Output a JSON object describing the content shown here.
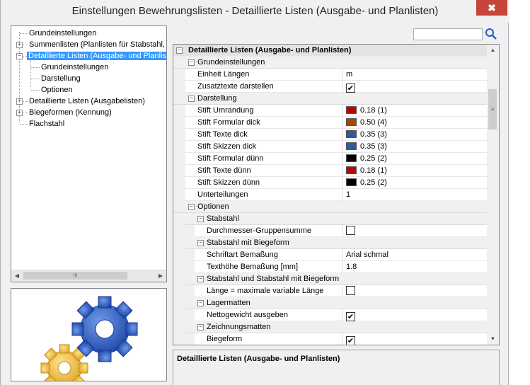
{
  "window": {
    "title": "Einstellungen Bewehrungslisten - Detaillierte Listen (Ausgabe- und Planlisten)",
    "close_label": "✖"
  },
  "tree": {
    "items": [
      {
        "label": "Grundeinstellungen"
      },
      {
        "label": "Summenlisten (Planlisten für Stabstahl, Ma"
      },
      {
        "label": "Detaillierte Listen (Ausgabe- und Planliste"
      },
      {
        "label": "Grundeinstellungen"
      },
      {
        "label": "Darstellung"
      },
      {
        "label": "Optionen"
      },
      {
        "label": "Detaillierte Listen (Ausgabelisten)"
      },
      {
        "label": "Biegeformen (Kennung)"
      },
      {
        "label": "Flachstahl"
      }
    ],
    "scroll_thumb": "III"
  },
  "search": {
    "value": "",
    "placeholder": ""
  },
  "colors": {
    "red": "#c00000",
    "brown": "#a04b00",
    "blue": "#2e5c99",
    "black": "#000000",
    "selection": "#3399ff",
    "close": "#c7453b",
    "gear_blue": "#2f63c4",
    "gear_yellow": "#f2c14e"
  },
  "grid": {
    "top": {
      "label": "Detaillierte Listen (Ausgabe- und Planlisten)"
    },
    "grundeinstellungen": {
      "label": "Grundeinstellungen",
      "einheit_label": "Einheit Längen",
      "einheit_value": "m",
      "zusatz_label": "Zusatztexte darstellen",
      "zusatz_checked": true
    },
    "darstellung": {
      "label": "Darstellung",
      "stifte": [
        {
          "label": "Stift Umrandung",
          "value": "0.18 (1)",
          "color": "red"
        },
        {
          "label": "Stift Formular dick",
          "value": "0.50 (4)",
          "color": "brown"
        },
        {
          "label": "Stift Texte dick",
          "value": "0.35 (3)",
          "color": "blue"
        },
        {
          "label": "Stift Skizzen dick",
          "value": "0.35 (3)",
          "color": "blue"
        },
        {
          "label": "Stift Formular dünn",
          "value": "0.25 (2)",
          "color": "black"
        },
        {
          "label": "Stift Texte dünn",
          "value": "0.18 (1)",
          "color": "red"
        },
        {
          "label": "Stift Skizzen dünn",
          "value": "0.25 (2)",
          "color": "black"
        }
      ],
      "unterteilungen_label": "Unterteilungen",
      "unterteilungen_value": "1"
    },
    "optionen": {
      "label": "Optionen",
      "stabstahl": {
        "label": "Stabstahl",
        "durchmesser_label": "Durchmesser-Gruppensumme",
        "durchmesser_checked": false
      },
      "biegeform": {
        "label": "Stabstahl mit Biegeform",
        "schriftart_label": "Schriftart Bemaßung",
        "schriftart_value": "Arial schmal",
        "texthoehe_label": "Texthöhe Bemaßung [mm]",
        "texthoehe_value": "1.8"
      },
      "beide": {
        "label": "Stabstahl und Stabstahl mit Biegeform",
        "laenge_label": "Länge = maximale variable Länge",
        "laenge_checked": false
      },
      "lagermatten": {
        "label": "Lagermatten",
        "netto_label": "Nettogewicht ausgeben",
        "netto_checked": true
      },
      "zeichnungsmatten": {
        "label": "Zeichnungsmatten",
        "biegeform_label": "Biegeform",
        "biegeform_checked": true
      }
    },
    "checkmark": "✔",
    "scroll_grip": "≡"
  },
  "description": {
    "title": "Detaillierte Listen (Ausgabe- und Planlisten)"
  }
}
